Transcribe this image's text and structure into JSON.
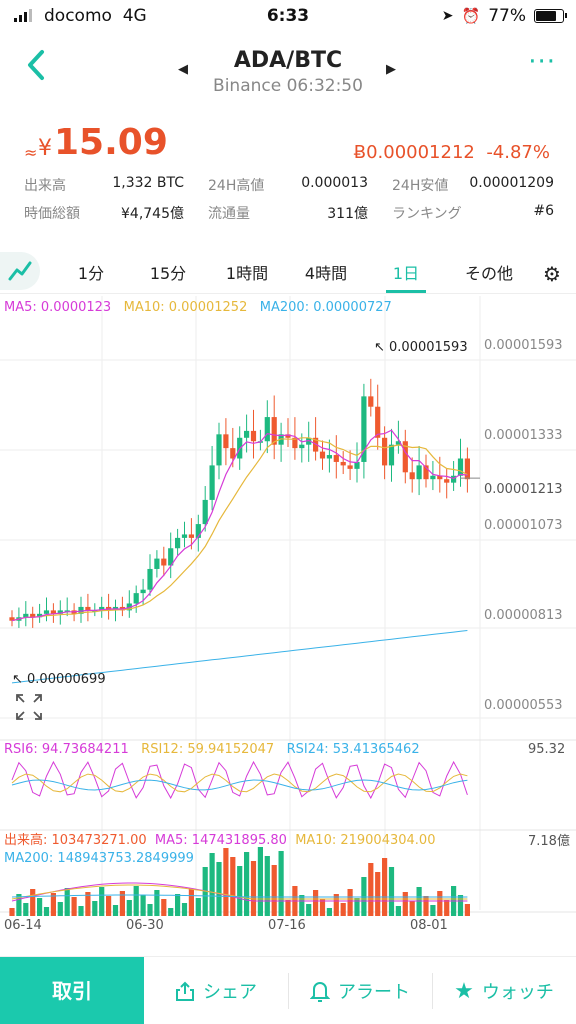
{
  "status": {
    "carrier": "docomo",
    "network": "4G",
    "time": "6:33",
    "battery": "77%"
  },
  "header": {
    "title": "ADA/BTC",
    "subtitle": "Binance 06:32:50"
  },
  "price": {
    "approx_symbol": "≈",
    "currency": "¥",
    "value": "15.09",
    "btc_price": "Ƀ0.00001212",
    "change": "-4.87%"
  },
  "stats": {
    "volume_label": "出来高",
    "volume_value": "1,332 BTC",
    "high_label": "24H高値",
    "high_value": "0.000013",
    "low_label": "24H安値",
    "low_value": "0.00001209",
    "mcap_label": "時価総額",
    "mcap_value": "¥4,745億",
    "supply_label": "流通量",
    "supply_value": "311億",
    "rank_label": "ランキング",
    "rank_value": "#6"
  },
  "tabs": [
    "1分",
    "15分",
    "1時間",
    "4時間",
    "1日",
    "その他"
  ],
  "active_tab": "1日",
  "chart_legend": {
    "ma5": "MA5: 0.0000123",
    "ma10": "MA10: 0.00001252",
    "ma200": "MA200: 0.00000727",
    "rsi6": "RSI6: 94.73684211",
    "rsi12": "RSI12: 59.94152047",
    "rsi24": "RSI24: 53.41365462",
    "rsi_max": "95.32",
    "vol": "出来高: 103473271.00",
    "vol_ma5": "MA5: 147431895.80",
    "vol_ma10": "MA10: 219004304.00",
    "vol_ma200": "MA200: 148943753.2849999",
    "vol_max": "7.18億"
  },
  "axis": [
    "0.00001593",
    "0.00001333",
    "0.00001213",
    "0.00001073",
    "0.00000813",
    "0.00000553"
  ],
  "annotations": {
    "high": "0.00001593",
    "low": "0.00000699"
  },
  "dates": [
    "06-14",
    "06-30",
    "07-16",
    "08-01"
  ],
  "colors": {
    "up": "#1db980",
    "down": "#ef5a2f",
    "ma5": "#d63bd8",
    "ma10": "#e6b83c",
    "ma200": "#3ab2e8",
    "accent": "#1bbfa6"
  },
  "bottom": {
    "trade": "取引",
    "share": "シェア",
    "alert": "アラート",
    "watch": "ウォッチ"
  },
  "chart_data": {
    "type": "candlestick",
    "x": [
      "06-14",
      "06-30",
      "07-16",
      "08-01"
    ],
    "y_ticks": [
      1.593e-05,
      1.333e-05,
      1.213e-05,
      1.073e-05,
      8.13e-06,
      5.53e-06
    ],
    "high": 1.593e-05,
    "low": 6.99e-06,
    "last": 1.213e-05
  }
}
